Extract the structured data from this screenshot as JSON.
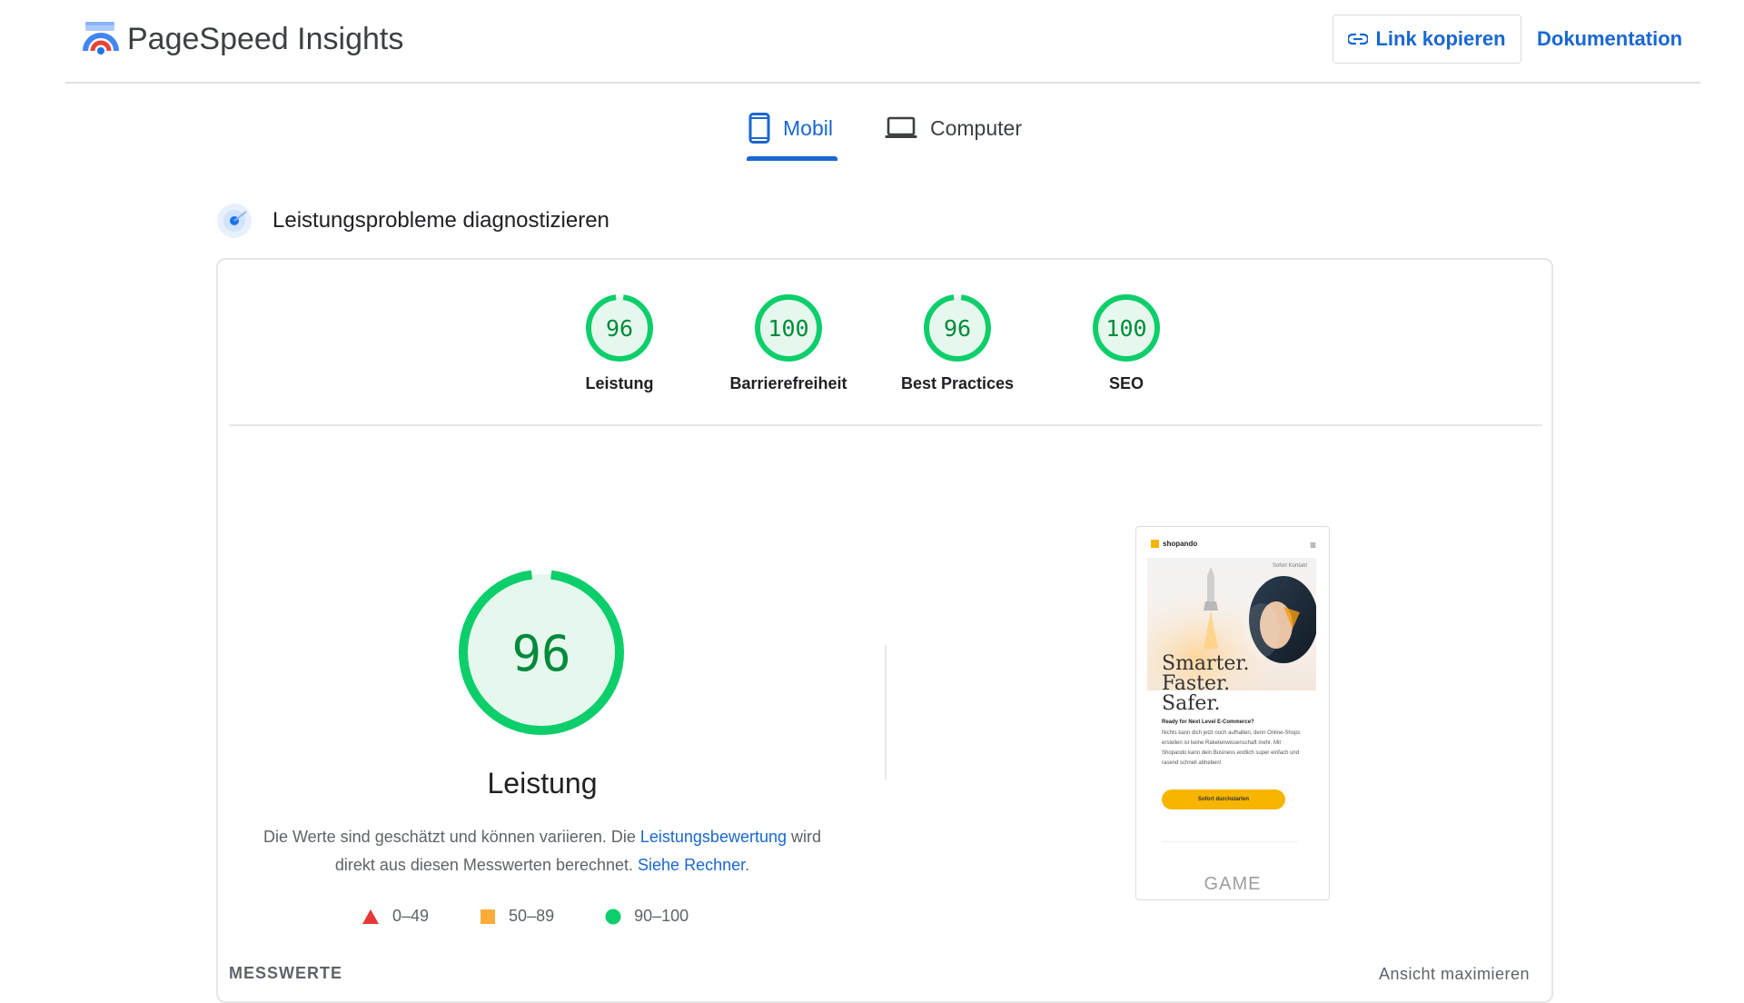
{
  "app": {
    "title": "PageSpeed Insights"
  },
  "header": {
    "copy_link_label": "Link kopieren",
    "docs_label": "Dokumentation"
  },
  "tabs": [
    {
      "label": "Mobil",
      "active": true,
      "icon": "smartphone-icon"
    },
    {
      "label": "Computer",
      "active": false,
      "icon": "laptop-icon"
    }
  ],
  "diagnose": {
    "title": "Leistungsprobleme diagnostizieren"
  },
  "scores": [
    {
      "label": "Leistung",
      "value": 96
    },
    {
      "label": "Barrierefreiheit",
      "value": 100
    },
    {
      "label": "Best Practices",
      "value": 96
    },
    {
      "label": "SEO",
      "value": 100
    }
  ],
  "performance": {
    "score": "96",
    "score_value": 96,
    "title": "Leistung",
    "desc_part1": "Die Werte sind geschätzt und können variieren. Die ",
    "desc_link1": "Leistungsbewertung",
    "desc_part2": " wird direkt aus diesen Messwerten berechnet. ",
    "desc_link2": "Siehe Rechner",
    "desc_part3": "."
  },
  "legend": [
    {
      "range": "0–49",
      "shape": "triangle",
      "color": "#e53935"
    },
    {
      "range": "50–89",
      "shape": "square",
      "color": "#fbab3a"
    },
    {
      "range": "90–100",
      "shape": "circle",
      "color": "#0cce6b"
    }
  ],
  "screenshot": {
    "brand": "shopando",
    "contact": "Sofort Kontakt",
    "headline": [
      "Smarter.",
      "Faster.",
      "Safer."
    ],
    "subheading": "Ready for Next Level E-Commerce?",
    "body": "Nichts kann dich jetzt noch aufhalten, denn Online-Shops erstellen ist keine Raketenwissenschaft mehr. Mit Shopando kann dein Business endlich super einfach und rasend schnell abheben!",
    "cta": "Sofort durchstarten",
    "footer": "GAME"
  },
  "metrics": {
    "label": "MESSWERTE",
    "expand_label": "Ansicht maximieren"
  },
  "colors": {
    "accent": "#1967d2",
    "good": "#0cce6b",
    "good_bg": "#e6f8ee",
    "good_text": "#008a3a"
  }
}
